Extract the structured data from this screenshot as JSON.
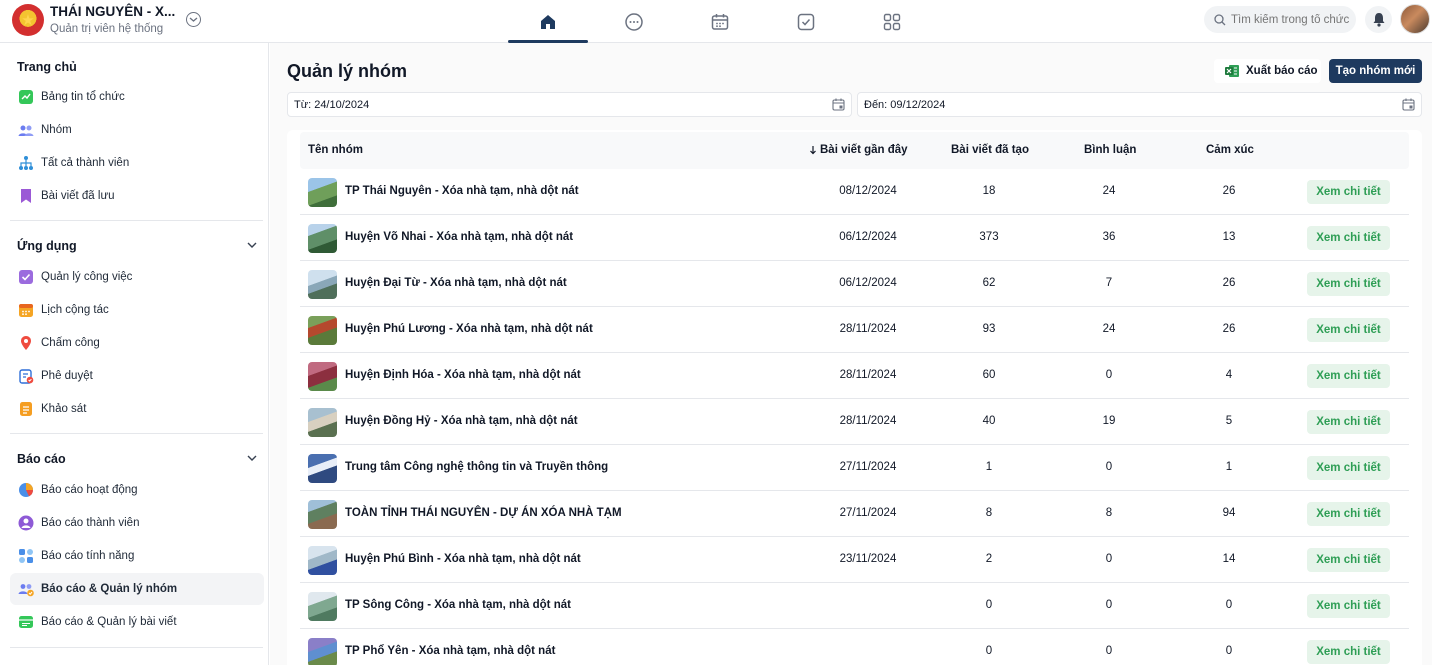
{
  "header": {
    "org_name": "THÁI NGUYÊN - X...",
    "org_role": "Quản trị viên hệ thống",
    "nav": [
      {
        "icon": "home-icon",
        "active": true
      },
      {
        "icon": "chat-icon",
        "active": false
      },
      {
        "icon": "calendar-icon",
        "active": false
      },
      {
        "icon": "check-square-icon",
        "active": false
      },
      {
        "icon": "apps-grid-icon",
        "active": false
      }
    ],
    "search_placeholder": "Tìm kiếm trong tổ chức"
  },
  "sidebar": {
    "home": {
      "title": "Trang chủ",
      "items": [
        {
          "label": "Bảng tin tổ chức",
          "icon": "newsfeed-icon"
        },
        {
          "label": "Nhóm",
          "icon": "group-icon"
        },
        {
          "label": "Tất cả thành viên",
          "icon": "members-tree-icon"
        },
        {
          "label": "Bài viết đã lưu",
          "icon": "bookmark-icon"
        }
      ]
    },
    "apps": {
      "title": "Ứng dụng",
      "items": [
        {
          "label": "Quản lý công việc",
          "icon": "task-icon"
        },
        {
          "label": "Lịch cộng tác",
          "icon": "calendar-icon"
        },
        {
          "label": "Chấm công",
          "icon": "location-pin-icon"
        },
        {
          "label": "Phê duyệt",
          "icon": "approval-icon"
        },
        {
          "label": "Khảo sát",
          "icon": "survey-icon"
        }
      ]
    },
    "reports": {
      "title": "Báo cáo",
      "items": [
        {
          "label": "Báo cáo hoạt động",
          "icon": "pie-chart-icon"
        },
        {
          "label": "Báo cáo thành viên",
          "icon": "user-report-icon"
        },
        {
          "label": "Báo cáo tính năng",
          "icon": "feature-report-icon"
        },
        {
          "label": "Báo cáo & Quản lý nhóm",
          "icon": "group-report-icon",
          "active": true
        },
        {
          "label": "Báo cáo & Quản lý bài viết",
          "icon": "post-report-icon"
        }
      ]
    }
  },
  "main": {
    "title": "Quản lý nhóm",
    "export_label": "Xuất báo cáo",
    "new_group_label": "Tạo nhóm mới",
    "date_from": "Từ: 24/10/2024",
    "date_to": "Đến: 09/12/2024",
    "columns": {
      "name": "Tên nhóm",
      "recent": "Bài viết gần đây",
      "posts": "Bài viết đã tạo",
      "comments": "Bình luận",
      "reactions": "Cảm xúc"
    },
    "view_label": "Xem chi tiết",
    "rows": [
      {
        "name": "TP Thái Nguyên - Xóa nhà tạm, nhà dột nát",
        "recent": "08/12/2024",
        "posts": "18",
        "comments": "24",
        "reactions": "26"
      },
      {
        "name": "Huyện Võ Nhai - Xóa nhà tạm, nhà dột nát",
        "recent": "06/12/2024",
        "posts": "373",
        "comments": "36",
        "reactions": "13"
      },
      {
        "name": "Huyện Đại Từ - Xóa nhà tạm, nhà dột nát",
        "recent": "06/12/2024",
        "posts": "62",
        "comments": "7",
        "reactions": "26"
      },
      {
        "name": "Huyện Phú Lương - Xóa nhà tạm, nhà dột nát",
        "recent": "28/11/2024",
        "posts": "93",
        "comments": "24",
        "reactions": "26"
      },
      {
        "name": "Huyện Định Hóa - Xóa nhà tạm, nhà dột nát",
        "recent": "28/11/2024",
        "posts": "60",
        "comments": "0",
        "reactions": "4"
      },
      {
        "name": "Huyện Đồng Hỷ - Xóa nhà tạm, nhà dột nát",
        "recent": "28/11/2024",
        "posts": "40",
        "comments": "19",
        "reactions": "5"
      },
      {
        "name": "Trung tâm Công nghệ thông tin và Truyền thông",
        "recent": "27/11/2024",
        "posts": "1",
        "comments": "0",
        "reactions": "1"
      },
      {
        "name": "TOÀN TỈNH THÁI NGUYÊN - DỰ ÁN XÓA NHÀ TẠM",
        "recent": "27/11/2024",
        "posts": "8",
        "comments": "8",
        "reactions": "94"
      },
      {
        "name": "Huyện Phú Bình - Xóa nhà tạm, nhà dột nát",
        "recent": "23/11/2024",
        "posts": "2",
        "comments": "0",
        "reactions": "14"
      },
      {
        "name": "TP Sông Công - Xóa nhà tạm, nhà dột nát",
        "recent": "",
        "posts": "0",
        "comments": "0",
        "reactions": "0"
      },
      {
        "name": "TP Phổ Yên - Xóa nhà tạm, nhà dột nát",
        "recent": "",
        "posts": "0",
        "comments": "0",
        "reactions": "0"
      }
    ]
  }
}
